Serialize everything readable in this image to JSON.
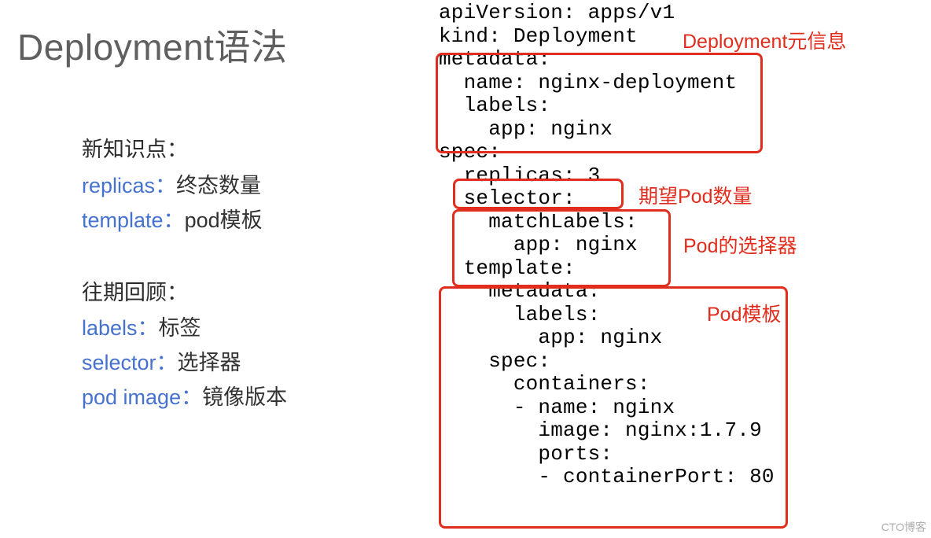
{
  "title": "Deployment语法",
  "left": {
    "section1_title": "新知识点：",
    "item1_key": "replicas：",
    "item1_val": "终态数量",
    "item2_key": "template：",
    "item2_val": "pod模板",
    "section2_title": "往期回顾：",
    "item3_key": "labels：",
    "item3_val": "标签",
    "item4_key": "selector：",
    "item4_val": "选择器",
    "item5_key": "pod image：",
    "item5_val": "镜像版本"
  },
  "code_text": "apiVersion: apps/v1\nkind: Deployment\nmetadata:\n  name: nginx-deployment\n  labels:\n    app: nginx\nspec:\n  replicas: 3\n  selector:\n    matchLabels:\n      app: nginx\n  template:\n    metadata:\n      labels:\n        app: nginx\n    spec:\n      containers:\n      - name: nginx\n        image: nginx:1.7.9\n        ports:\n        - containerPort: 80",
  "annotations": {
    "meta": "Deployment元信息",
    "replicas": "期望Pod数量",
    "selector": "Pod的选择器",
    "template": "Pod模板"
  },
  "yaml_data": {
    "apiVersion": "apps/v1",
    "kind": "Deployment",
    "metadata": {
      "name": "nginx-deployment",
      "labels": {
        "app": "nginx"
      }
    },
    "spec": {
      "replicas": 3,
      "selector": {
        "matchLabels": {
          "app": "nginx"
        }
      },
      "template": {
        "metadata": {
          "labels": {
            "app": "nginx"
          }
        },
        "spec": {
          "containers": [
            {
              "name": "nginx",
              "image": "nginx:1.7.9",
              "ports": [
                {
                  "containerPort": 80
                }
              ]
            }
          ]
        }
      }
    }
  },
  "watermark": "CTO博客"
}
